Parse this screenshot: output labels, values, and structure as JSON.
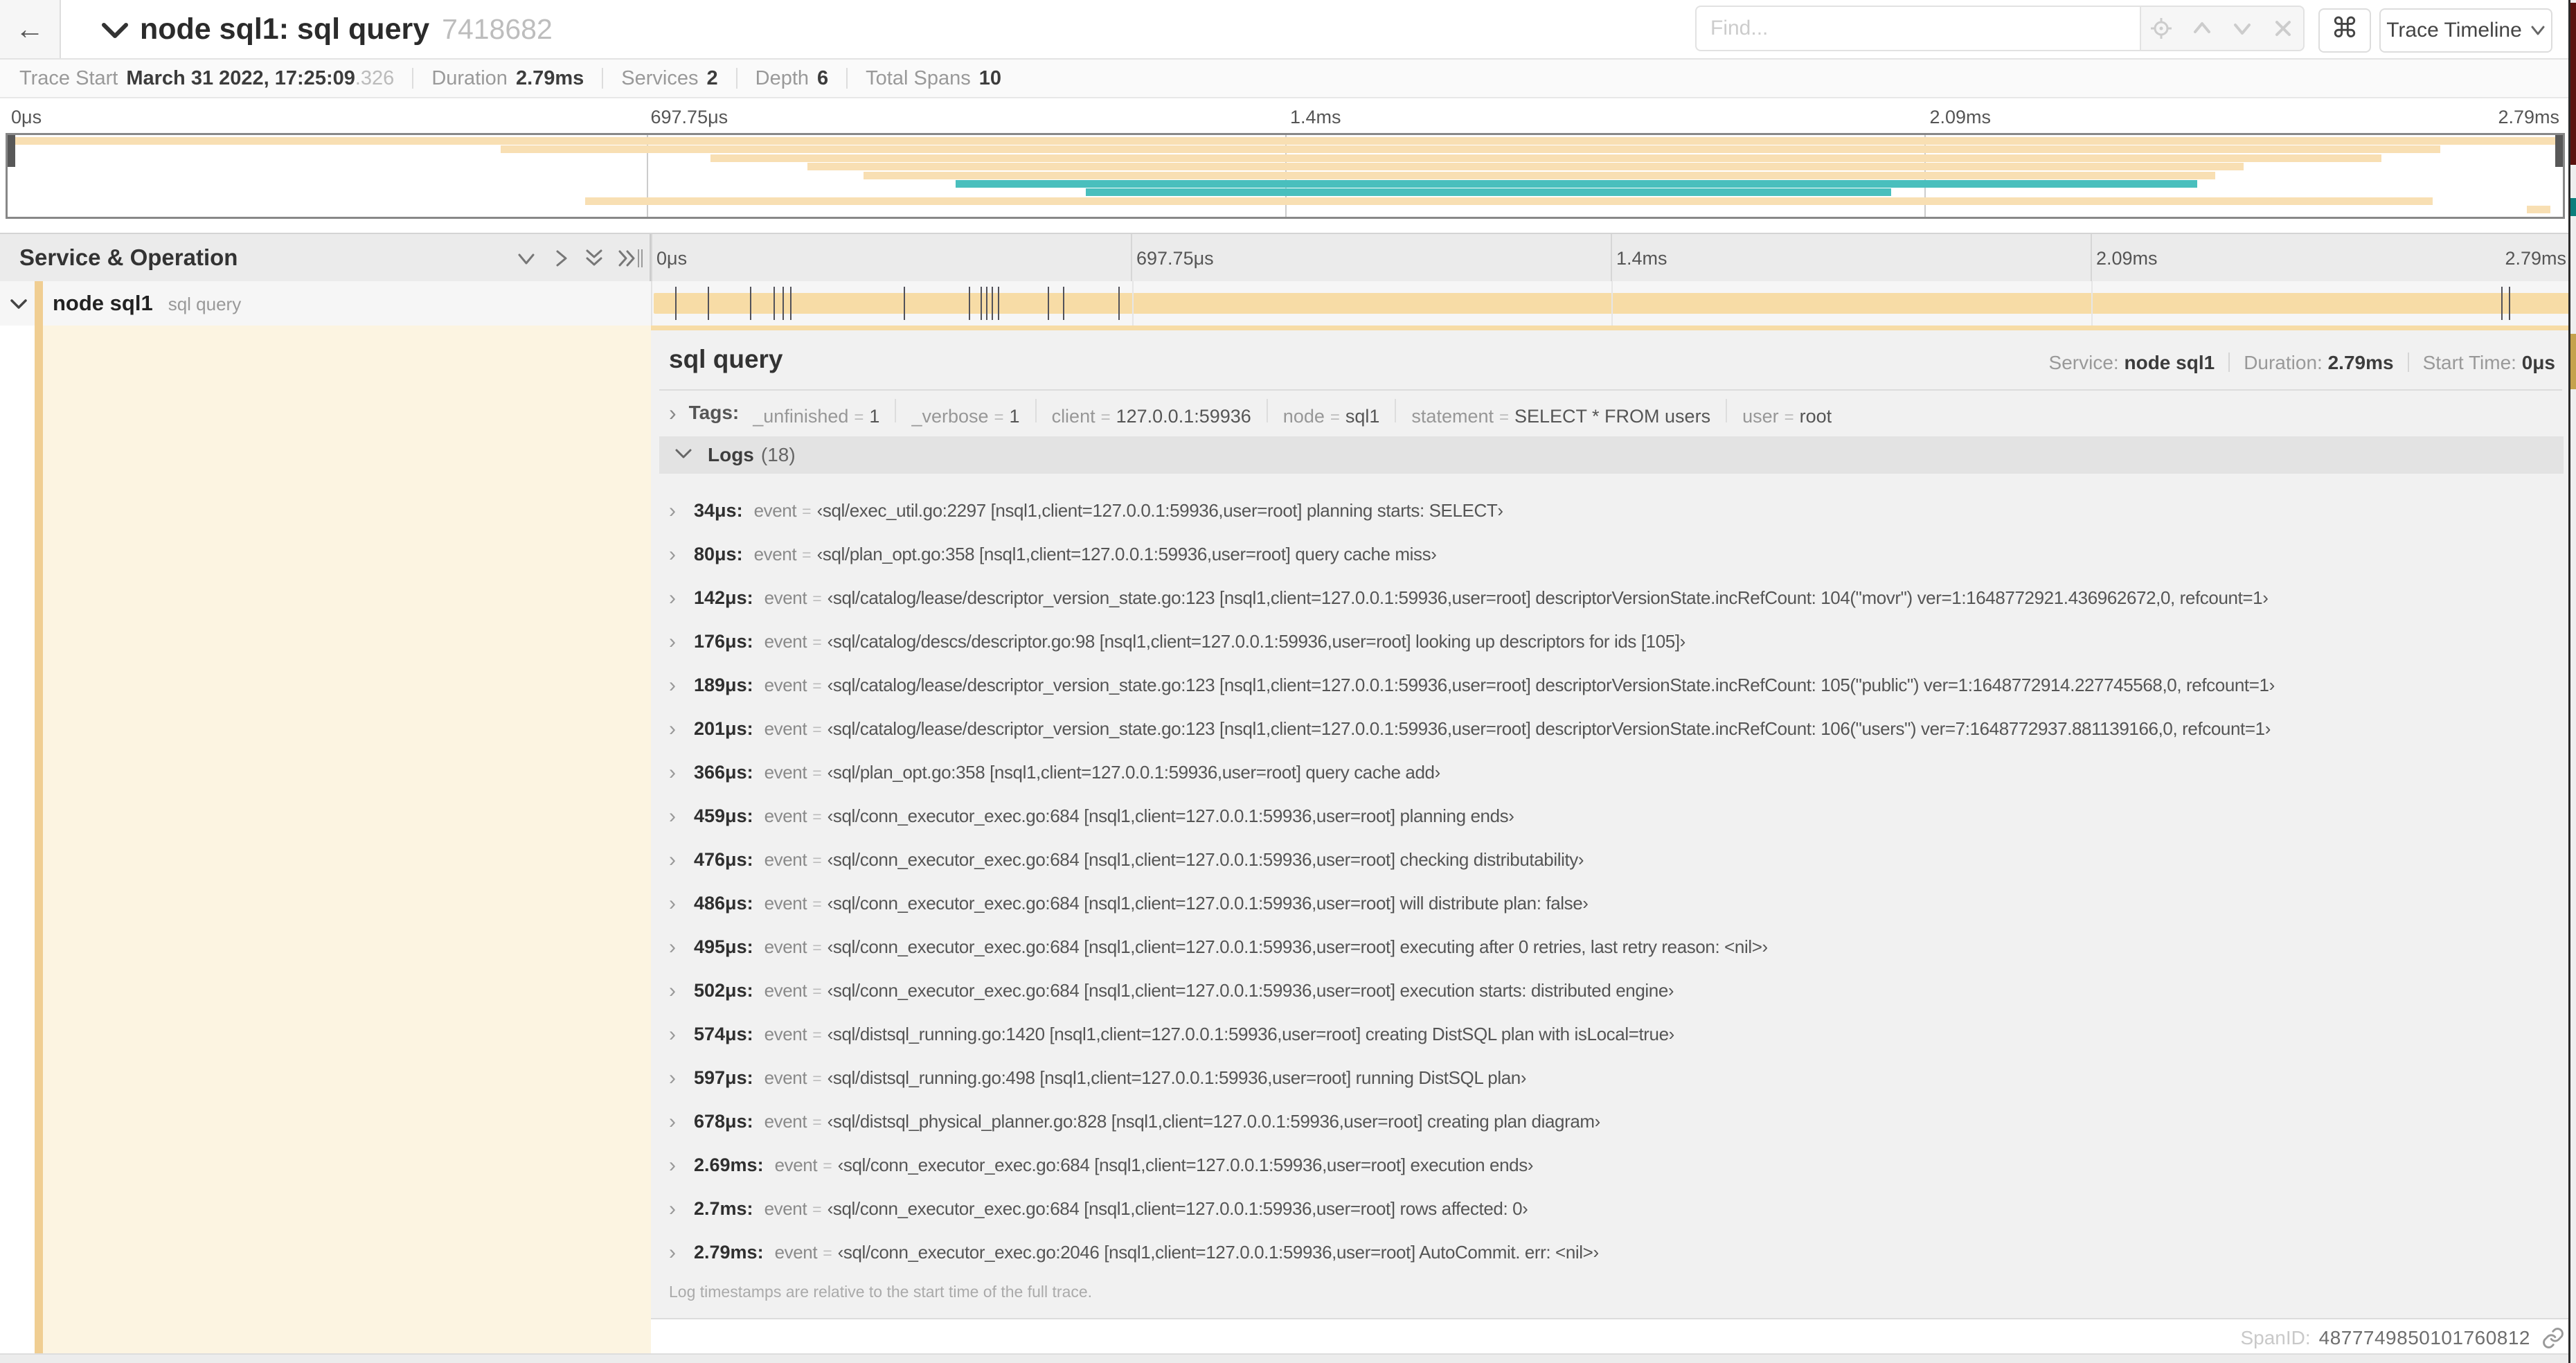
{
  "header": {
    "back_icon": "←",
    "title": "node sql1: sql query",
    "trace_id": "7418682",
    "find_placeholder": "Find...",
    "shortcut_symbol": "⌘",
    "view_selector": "Trace Timeline"
  },
  "summary_bar": {
    "items": [
      {
        "label": "Trace Start",
        "value": "March 31 2022, 17:25:09",
        "suffix": ".326"
      },
      {
        "label": "Duration",
        "value": "2.79ms"
      },
      {
        "label": "Services",
        "value": "2"
      },
      {
        "label": "Depth",
        "value": "6"
      },
      {
        "label": "Total Spans",
        "value": "10"
      }
    ]
  },
  "timeline": {
    "column_header": "Service & Operation",
    "ticks": [
      {
        "label": "0μs",
        "pct": 0
      },
      {
        "label": "697.75μs",
        "pct": 25
      },
      {
        "label": "1.4ms",
        "pct": 50
      },
      {
        "label": "2.09ms",
        "pct": 75
      },
      {
        "label": "2.79ms",
        "pct": 100
      }
    ]
  },
  "minimap": {
    "spans": [
      {
        "start": 0,
        "end": 100,
        "color": "cream"
      },
      {
        "start": 19.3,
        "end": 95.2,
        "color": "cream"
      },
      {
        "start": 27.5,
        "end": 92.9,
        "color": "cream"
      },
      {
        "start": 31.3,
        "end": 87.5,
        "color": "cream"
      },
      {
        "start": 33.5,
        "end": 86.4,
        "color": "cream"
      },
      {
        "start": 37.1,
        "end": 85.7,
        "color": "teal"
      },
      {
        "start": 42.2,
        "end": 73.7,
        "color": "teal"
      },
      {
        "start": 22.6,
        "end": 94.9,
        "color": "cream"
      },
      {
        "start": 98.6,
        "end": 99.5,
        "color": "cream"
      }
    ]
  },
  "span_row": {
    "service": "node sql1",
    "operation": "sql query",
    "log_marker_pcts": [
      1.2,
      2.9,
      5.1,
      6.3,
      6.8,
      7.2,
      13.1,
      16.5,
      17.1,
      17.4,
      17.7,
      18.0,
      20.6,
      21.4,
      24.3,
      96.4,
      96.8
    ]
  },
  "detail": {
    "operation": "sql query",
    "meta": [
      {
        "label": "Service:",
        "value": "node sql1"
      },
      {
        "label": "Duration:",
        "value": "2.79ms"
      },
      {
        "label": "Start Time:",
        "value": "0μs"
      }
    ],
    "tags_label": "Tags:",
    "tags": [
      {
        "key": "_unfinished",
        "value": "1"
      },
      {
        "key": "_verbose",
        "value": "1"
      },
      {
        "key": "client",
        "value": "127.0.0.1:59936"
      },
      {
        "key": "node",
        "value": "sql1"
      },
      {
        "key": "statement",
        "value": "SELECT * FROM users"
      },
      {
        "key": "user",
        "value": "root"
      }
    ],
    "logs_label": "Logs",
    "logs_count": "(18)",
    "logs": [
      {
        "time": "34μs:",
        "field": "event",
        "value": "‹sql/exec_util.go:2297 [nsql1,client=127.0.0.1:59936,user=root] planning starts: SELECT›"
      },
      {
        "time": "80μs:",
        "field": "event",
        "value": "‹sql/plan_opt.go:358 [nsql1,client=127.0.0.1:59936,user=root] query cache miss›"
      },
      {
        "time": "142μs:",
        "field": "event",
        "value": "‹sql/catalog/lease/descriptor_version_state.go:123 [nsql1,client=127.0.0.1:59936,user=root] descriptorVersionState.incRefCount: 104(\"movr\") ver=1:1648772921.436962672,0, refcount=1›"
      },
      {
        "time": "176μs:",
        "field": "event",
        "value": "‹sql/catalog/descs/descriptor.go:98 [nsql1,client=127.0.0.1:59936,user=root] looking up descriptors for ids [105]›"
      },
      {
        "time": "189μs:",
        "field": "event",
        "value": "‹sql/catalog/lease/descriptor_version_state.go:123 [nsql1,client=127.0.0.1:59936,user=root] descriptorVersionState.incRefCount: 105(\"public\") ver=1:1648772914.227745568,0, refcount=1›"
      },
      {
        "time": "201μs:",
        "field": "event",
        "value": "‹sql/catalog/lease/descriptor_version_state.go:123 [nsql1,client=127.0.0.1:59936,user=root] descriptorVersionState.incRefCount: 106(\"users\") ver=7:1648772937.881139166,0, refcount=1›"
      },
      {
        "time": "366μs:",
        "field": "event",
        "value": "‹sql/plan_opt.go:358 [nsql1,client=127.0.0.1:59936,user=root] query cache add›"
      },
      {
        "time": "459μs:",
        "field": "event",
        "value": "‹sql/conn_executor_exec.go:684 [nsql1,client=127.0.0.1:59936,user=root] planning ends›"
      },
      {
        "time": "476μs:",
        "field": "event",
        "value": "‹sql/conn_executor_exec.go:684 [nsql1,client=127.0.0.1:59936,user=root] checking distributability›"
      },
      {
        "time": "486μs:",
        "field": "event",
        "value": "‹sql/conn_executor_exec.go:684 [nsql1,client=127.0.0.1:59936,user=root] will distribute plan: false›"
      },
      {
        "time": "495μs:",
        "field": "event",
        "value": "‹sql/conn_executor_exec.go:684 [nsql1,client=127.0.0.1:59936,user=root] executing after 0 retries, last retry reason: <nil>›"
      },
      {
        "time": "502μs:",
        "field": "event",
        "value": "‹sql/conn_executor_exec.go:684 [nsql1,client=127.0.0.1:59936,user=root] execution starts: distributed engine›"
      },
      {
        "time": "574μs:",
        "field": "event",
        "value": "‹sql/distsql_running.go:1420 [nsql1,client=127.0.0.1:59936,user=root] creating DistSQL plan with isLocal=true›"
      },
      {
        "time": "597μs:",
        "field": "event",
        "value": "‹sql/distsql_running.go:498 [nsql1,client=127.0.0.1:59936,user=root] running DistSQL plan›"
      },
      {
        "time": "678μs:",
        "field": "event",
        "value": "‹sql/distsql_physical_planner.go:828 [nsql1,client=127.0.0.1:59936,user=root] creating plan diagram›"
      },
      {
        "time": "2.69ms:",
        "field": "event",
        "value": "‹sql/conn_executor_exec.go:684 [nsql1,client=127.0.0.1:59936,user=root] execution ends›"
      },
      {
        "time": "2.7ms:",
        "field": "event",
        "value": "‹sql/conn_executor_exec.go:684 [nsql1,client=127.0.0.1:59936,user=root] rows affected: 0›"
      },
      {
        "time": "2.79ms:",
        "field": "event",
        "value": "‹sql/conn_executor_exec.go:2046 [nsql1,client=127.0.0.1:59936,user=root] AutoCommit. err: <nil>›"
      }
    ],
    "footer_note": "Log timestamps are relative to the start time of the full trace.",
    "span_id_label": "SpanID:",
    "span_id": "4877749850101760812"
  },
  "colors": {
    "cream": "#F8DFB3",
    "cream_bar": "#F7DCA6",
    "cream_strip": "#F0CE92",
    "cream_pale": "#FCF4E1",
    "teal": "#49BFBD"
  }
}
